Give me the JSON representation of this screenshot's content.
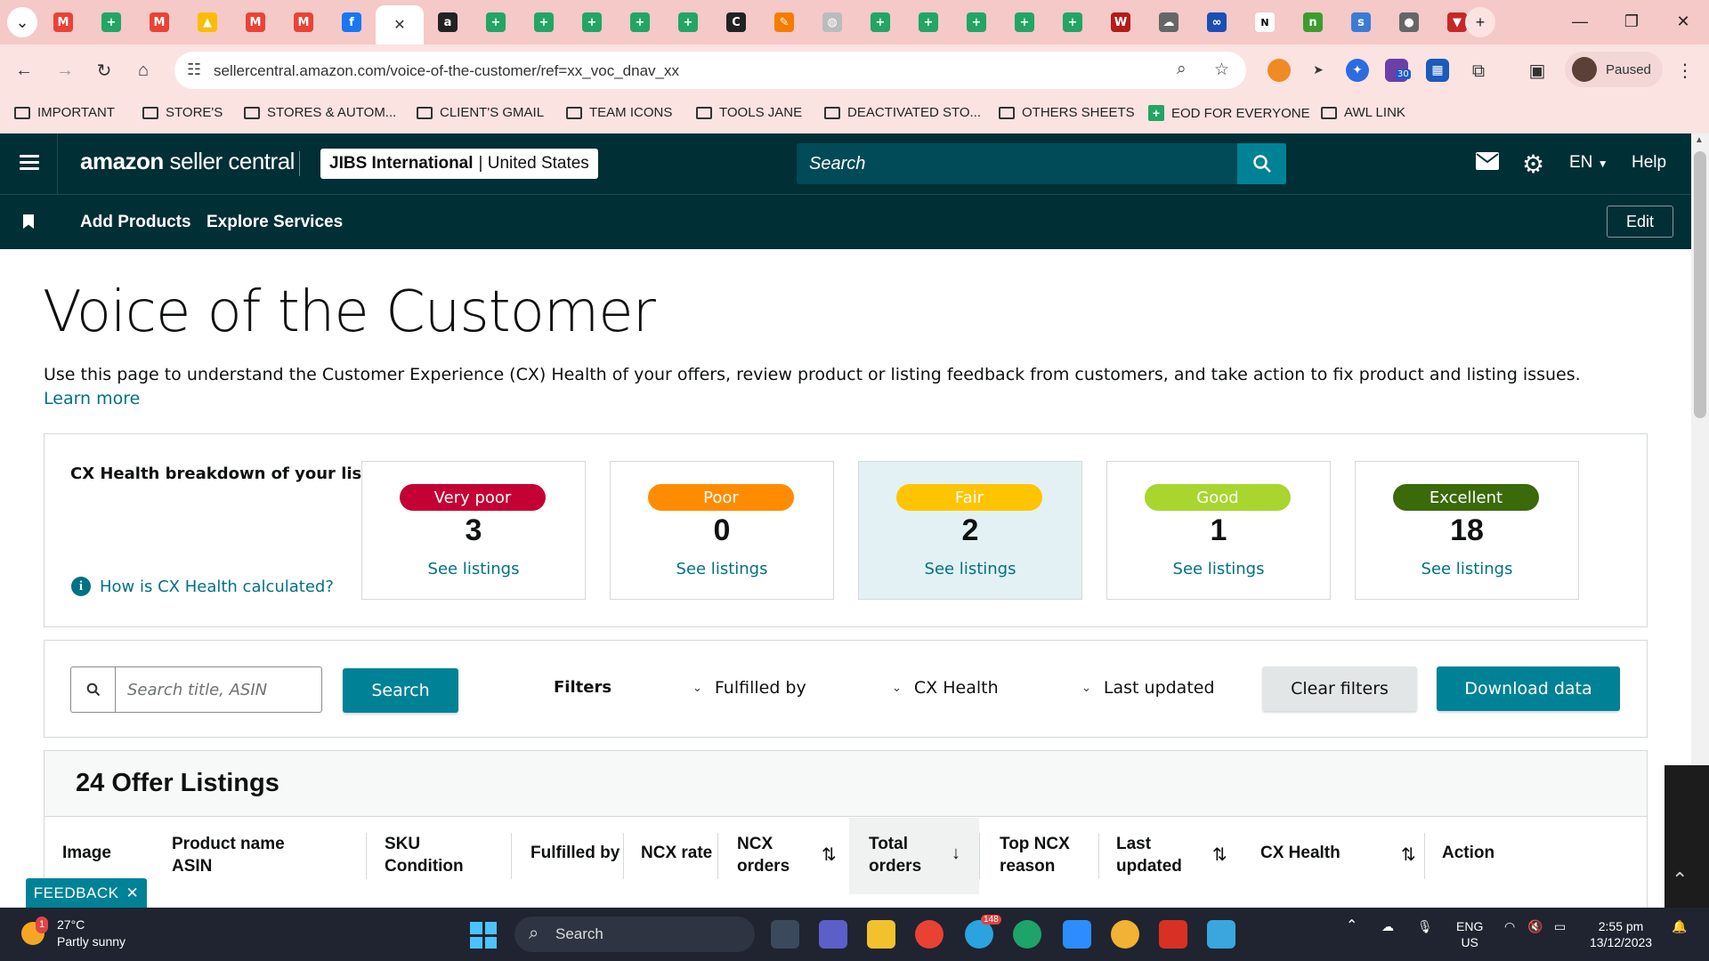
{
  "browser": {
    "url": "sellercentral.amazon.com/voice-of-the-customer/ref=xx_voc_dnav_xx",
    "profile_status": "Paused",
    "ext_badge": "30",
    "bookmarks": [
      {
        "label": "IMPORTANT",
        "icon": "folder-icon"
      },
      {
        "label": "STORE'S",
        "icon": "folder-icon"
      },
      {
        "label": "STORES & AUTOM...",
        "icon": "folder-icon"
      },
      {
        "label": "CLIENT'S GMAIL",
        "icon": "folder-icon"
      },
      {
        "label": "TEAM ICONS",
        "icon": "folder-icon"
      },
      {
        "label": "TOOLS JANE",
        "icon": "folder-icon"
      },
      {
        "label": "DEACTIVATED STO...",
        "icon": "folder-icon"
      },
      {
        "label": "OTHERS SHEETS",
        "icon": "folder-icon"
      },
      {
        "label": "EOD FOR EVERYONE",
        "icon": "sheets-icon"
      },
      {
        "label": "AWL LINK",
        "icon": "folder-icon"
      }
    ]
  },
  "header": {
    "logo_bold": "amazon",
    "logo_rest": " seller central",
    "account_name": "JIBS International",
    "account_region": "| United States",
    "search_placeholder": "Search",
    "language": "EN",
    "help": "Help",
    "nav_links": [
      "Add Products",
      "Explore Services"
    ],
    "edit": "Edit"
  },
  "page": {
    "title": "Voice of the Customer",
    "description": "Use this page to understand the Customer Experience (CX) Health of your offers, review product or listing feedback from customers, and take action to fix product and listing issues.",
    "learn_more": "Learn more"
  },
  "cx_health": {
    "label": "CX Health breakdown of your listings",
    "help_link": "How is CX Health calculated?",
    "cards": [
      {
        "status": "Very poor",
        "count": "3",
        "link": "See listings",
        "color": "#c40034",
        "text_color": "#ffffff"
      },
      {
        "status": "Poor",
        "count": "0",
        "link": "See listings",
        "color": "#ff8c00",
        "text_color": "#ffffff"
      },
      {
        "status": "Fair",
        "count": "2",
        "link": "See listings",
        "color": "#ffc400",
        "text_color": "#ffffff"
      },
      {
        "status": "Good",
        "count": "1",
        "link": "See listings",
        "color": "#a8d62f",
        "text_color": "#ffffff"
      },
      {
        "status": "Excellent",
        "count": "18",
        "link": "See listings",
        "color": "#3b6a0a",
        "text_color": "#ffffff"
      }
    ],
    "selected_index": 2
  },
  "filters": {
    "search_placeholder": "Search title, ASIN",
    "search_button": "Search",
    "filters_label": "Filters",
    "dropdowns": [
      "Fulfilled by",
      "CX Health",
      "Last updated"
    ],
    "clear": "Clear filters",
    "download": "Download data"
  },
  "listings": {
    "heading": "24 Offer Listings",
    "columns": [
      {
        "line1": "Image",
        "line2": ""
      },
      {
        "line1": "Product name",
        "line2": "ASIN"
      },
      {
        "line1": "SKU",
        "line2": "Condition"
      },
      {
        "line1": "Fulfilled by",
        "line2": ""
      },
      {
        "line1": "NCX rate",
        "line2": ""
      },
      {
        "line1": "NCX",
        "line2": "orders"
      },
      {
        "line1": "Total",
        "line2": "orders"
      },
      {
        "line1": "Top NCX",
        "line2": "reason"
      },
      {
        "line1": "Last",
        "line2": "updated"
      },
      {
        "line1": "CX Health",
        "line2": ""
      },
      {
        "line1": "Action",
        "line2": ""
      }
    ]
  },
  "feedback": "FEEDBACK",
  "taskbar": {
    "temperature": "27°C",
    "weather": "Partly sunny",
    "search": "Search",
    "lang1": "ENG",
    "lang2": "US",
    "time": "2:55 pm",
    "date": "13/12/2023",
    "weather_badge": "1",
    "telegram_badge": "148"
  }
}
